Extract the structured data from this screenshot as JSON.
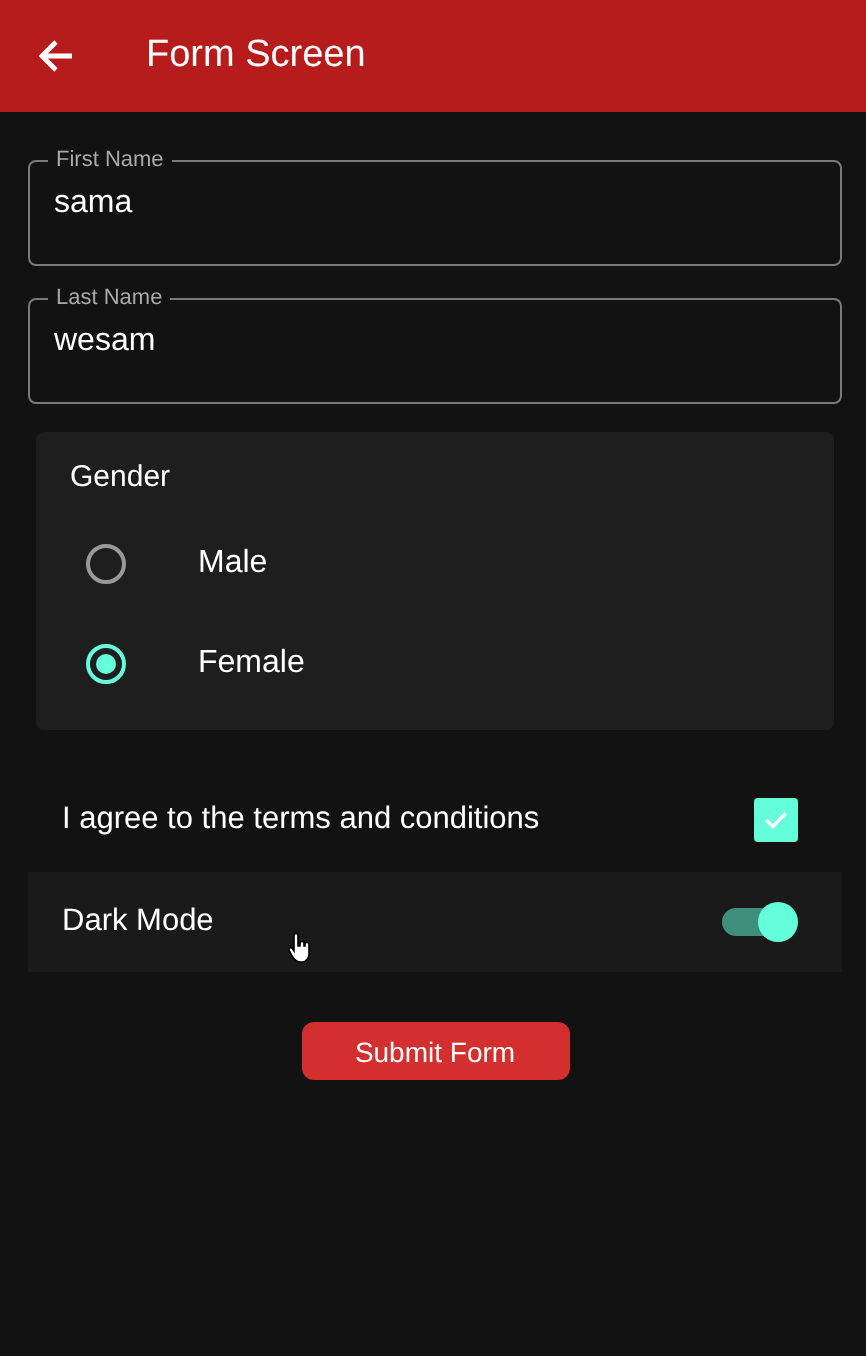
{
  "app_bar": {
    "title": "Form Screen"
  },
  "fields": [
    {
      "label": "First Name",
      "value": "sama"
    },
    {
      "label": "Last Name",
      "value": "wesam"
    }
  ],
  "gender": {
    "title": "Gender",
    "options": [
      {
        "label": "Male",
        "selected": false
      },
      {
        "label": "Female",
        "selected": true
      }
    ]
  },
  "terms": {
    "label": "I agree to the terms and conditions",
    "checked": true
  },
  "dark_mode": {
    "label": "Dark Mode",
    "on": true
  },
  "submit": {
    "label": "Submit Form"
  }
}
